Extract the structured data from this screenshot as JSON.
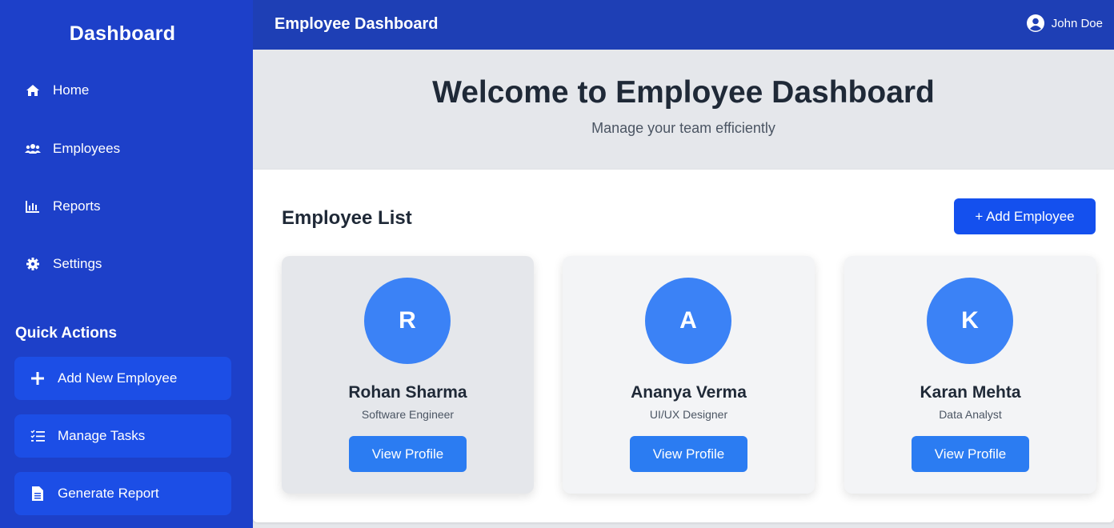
{
  "sidebar": {
    "title": "Dashboard",
    "nav": [
      {
        "label": "Home",
        "icon": "home-icon"
      },
      {
        "label": "Employees",
        "icon": "users-icon"
      },
      {
        "label": "Reports",
        "icon": "chart-icon"
      },
      {
        "label": "Settings",
        "icon": "gear-icon"
      }
    ],
    "quick_actions_title": "Quick Actions",
    "quick_actions": [
      {
        "label": "Add New Employee",
        "icon": "plus-icon"
      },
      {
        "label": "Manage Tasks",
        "icon": "tasks-icon"
      },
      {
        "label": "Generate Report",
        "icon": "file-icon"
      }
    ]
  },
  "header": {
    "title": "Employee Dashboard",
    "user_name": "John Doe"
  },
  "hero": {
    "title": "Welcome to Employee Dashboard",
    "subtitle": "Manage your team efficiently"
  },
  "employee_list": {
    "title": "Employee List",
    "add_label": "+ Add Employee",
    "view_label": "View Profile",
    "employees": [
      {
        "initial": "R",
        "name": "Rohan Sharma",
        "role": "Software Engineer"
      },
      {
        "initial": "A",
        "name": "Ananya Verma",
        "role": "UI/UX Designer"
      },
      {
        "initial": "K",
        "name": "Karan Mehta",
        "role": "Data Analyst"
      }
    ]
  },
  "colors": {
    "sidebar": "#1d40c9",
    "header": "#1e3fb5",
    "accent": "#1450ee",
    "avatar": "#3b82f6"
  }
}
